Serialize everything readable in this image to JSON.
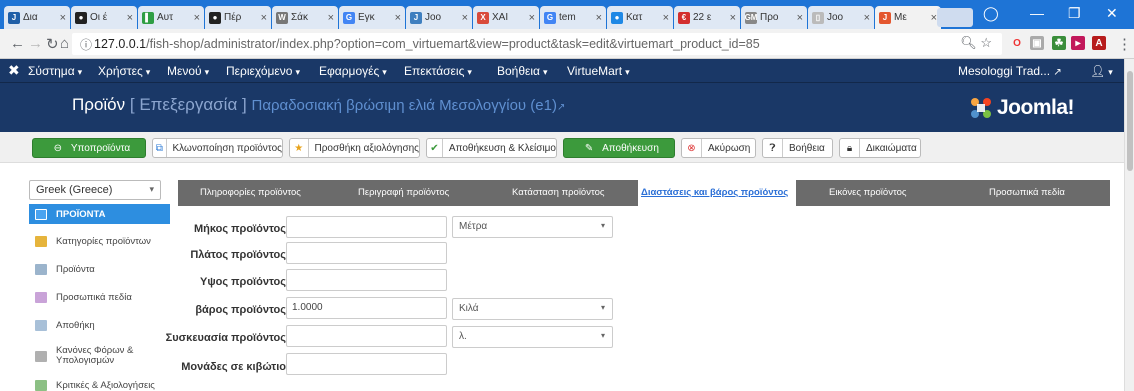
{
  "browser": {
    "tabs": [
      {
        "label": "Δια",
        "color": "#1f5fa8",
        "glyph": "J"
      },
      {
        "label": "Οι έ",
        "color": "#222222",
        "glyph": "●"
      },
      {
        "label": "Αυτ",
        "color": "#2f9e44",
        "glyph": "▌"
      },
      {
        "label": "Πέρ",
        "color": "#222222",
        "glyph": "●"
      },
      {
        "label": "Σάκ",
        "color": "#777777",
        "glyph": "W"
      },
      {
        "label": "Εγκ",
        "color": "#4285f4",
        "glyph": "G"
      },
      {
        "label": "Joo",
        "color": "#3f7fbf",
        "glyph": "J"
      },
      {
        "label": "XAI",
        "color": "#d94b3b",
        "glyph": "X"
      },
      {
        "label": "tem",
        "color": "#4285f4",
        "glyph": "G"
      },
      {
        "label": "Κατ",
        "color": "#1e88e5",
        "glyph": "●"
      },
      {
        "label": "22 ε",
        "color": "#d32f2f",
        "glyph": "€"
      },
      {
        "label": "Προ",
        "color": "#888888",
        "glyph": "GM"
      },
      {
        "label": "Joo",
        "color": "#bbbbbb",
        "glyph": "▯"
      },
      {
        "label": "Με",
        "color": "#e4572e",
        "glyph": "J",
        "active": true
      }
    ],
    "url_host": "127.0.0.1",
    "url_rest": "/fish-shop/administrator/index.php?option=com_virtuemart&view=product&task=edit&virtuemart_product_id=85"
  },
  "menu": {
    "items": [
      "Σύστημα",
      "Χρήστες",
      "Μενού",
      "Περιεχόμενο",
      "Εφαρμογές",
      "Επεκτάσεις",
      "Βοήθεια",
      "VirtueMart"
    ],
    "site_name": "Mesologgi Trad..."
  },
  "header": {
    "title": "Προϊόν",
    "bracket_open": "[",
    "action": "Επεξεργασία",
    "bracket_close": "]",
    "subtitle": "Παραδοσιακή βρώσιμη ελιά Μεσολογγίου (e1)",
    "logo_text": "Joomla!"
  },
  "toolbar": {
    "subproducts": "Υποπροϊόντα",
    "clone": "Κλωνοποίηση προϊόντος",
    "add_review": "Προσθήκη αξιολόγησης",
    "save_close": "Αποθήκευση & Κλείσιμο",
    "save": "Αποθήκευση",
    "cancel": "Ακύρωση",
    "help": "Βοήθεια",
    "permissions": "Δικαιώματα"
  },
  "sidebar": {
    "language": "Greek (Greece)",
    "items": [
      {
        "label": "ΠΡΟΪΟΝΤΑ",
        "active": true
      },
      {
        "label": "Κατηγορίες προϊόντων"
      },
      {
        "label": "Προϊόντα"
      },
      {
        "label": "Προσωπικά πεδία"
      },
      {
        "label": "Αποθήκη"
      },
      {
        "label": "Κανόνες Φόρων & Υπολογισμών"
      },
      {
        "label": "Κριτικές & Αξιολογήσεις"
      }
    ]
  },
  "tabs": [
    "Πληροφορίες προϊόντος",
    "Περιγραφή προϊόντος",
    "Κατάσταση προϊόντος",
    "Διαστάσεις και βάρος προϊόντος",
    "Εικόνες προϊόντος",
    "Προσωπικά πεδία"
  ],
  "form": {
    "length_label": "Μήκος προϊόντος",
    "length_value": "",
    "length_unit": "Μέτρα",
    "width_label": "Πλάτος προϊόντος",
    "width_value": "",
    "height_label": "Υψος προϊόντος",
    "height_value": "",
    "weight_label": "βάρος προϊόντος",
    "weight_value": "1.0000",
    "weight_unit": "Κιλά",
    "packaging_label": "Συσκευασία προϊόντος",
    "packaging_value": "",
    "packaging_unit": "λ.",
    "units_box_label": "Μονάδες σε κιβώτιο",
    "units_box_value": ""
  },
  "colors": {
    "admin_bar": "#1a3867",
    "browser_bar": "#1e74d6",
    "active_side": "#2d8ee0",
    "green": "#3c9a3c"
  }
}
